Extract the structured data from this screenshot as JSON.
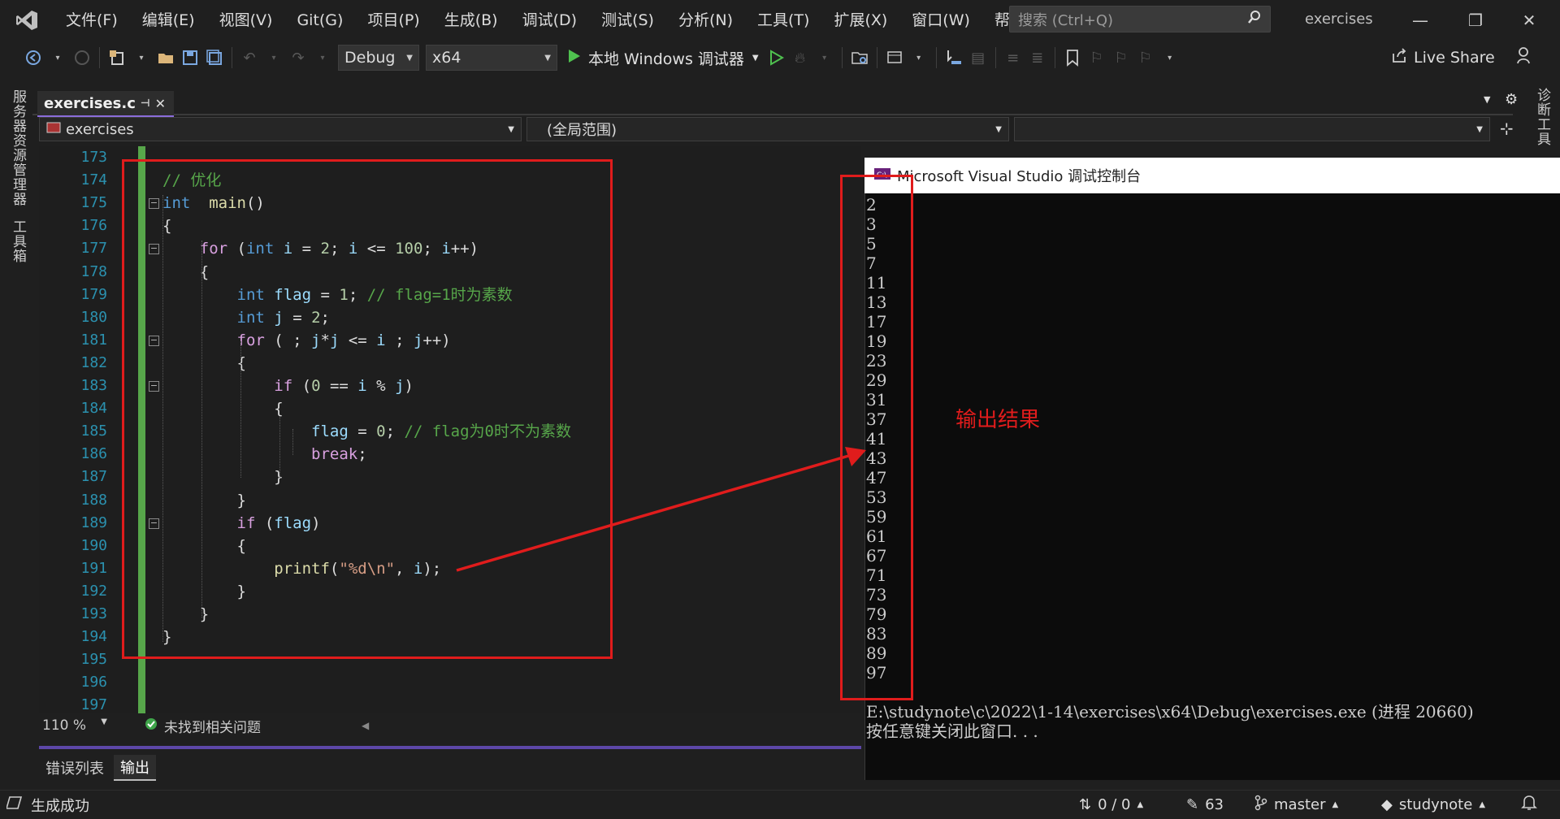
{
  "menubar": {
    "items": [
      "文件(F)",
      "编辑(E)",
      "视图(V)",
      "Git(G)",
      "项目(P)",
      "生成(B)",
      "调试(D)",
      "测试(S)",
      "分析(N)",
      "工具(T)",
      "扩展(X)",
      "窗口(W)",
      "帮助(H)"
    ],
    "search_placeholder": "搜索 (Ctrl+Q)",
    "solution_name": "exercises"
  },
  "toolbar": {
    "config": "Debug",
    "platform": "x64",
    "run_label": "本地 Windows 调试器",
    "live_share": "Live Share"
  },
  "left_rail": {
    "server_explorer": "服务器资源管理器",
    "toolbox": "工具箱"
  },
  "right_rail": {
    "diagnostic_tools": "诊断工具"
  },
  "editor_tab": {
    "filename": "exercises.c"
  },
  "navbar": {
    "project": "exercises",
    "scope": "(全局范围)",
    "member": ""
  },
  "code": {
    "line_numbers": [
      "173",
      "174",
      "175",
      "176",
      "177",
      "178",
      "179",
      "180",
      "181",
      "182",
      "183",
      "184",
      "185",
      "186",
      "187",
      "188",
      "189",
      "190",
      "191",
      "192",
      "193",
      "194",
      "195",
      "196",
      "197"
    ],
    "lines": [
      {
        "n": "173",
        "tokens": []
      },
      {
        "n": "174",
        "tokens": [
          [
            "cm",
            "// 优化"
          ]
        ]
      },
      {
        "n": "175",
        "tokens": [
          [
            "kw",
            "int"
          ],
          [
            "",
            "  "
          ],
          [
            "fn",
            "main"
          ],
          [
            "",
            "()"
          ]
        ]
      },
      {
        "n": "176",
        "tokens": [
          [
            "",
            "{"
          ]
        ]
      },
      {
        "n": "177",
        "tokens": [
          [
            "",
            "    "
          ],
          [
            "ctl",
            "for"
          ],
          [
            "",
            " ("
          ],
          [
            "kw",
            "int"
          ],
          [
            "",
            " "
          ],
          [
            "var",
            "i"
          ],
          [
            "",
            " = "
          ],
          [
            "num",
            "2"
          ],
          [
            "",
            "; "
          ],
          [
            "var",
            "i"
          ],
          [
            "",
            " <= "
          ],
          [
            "num",
            "100"
          ],
          [
            "",
            "; "
          ],
          [
            "var",
            "i"
          ],
          [
            "",
            "++)"
          ]
        ]
      },
      {
        "n": "178",
        "tokens": [
          [
            "",
            "    {"
          ]
        ]
      },
      {
        "n": "179",
        "tokens": [
          [
            "",
            "        "
          ],
          [
            "kw",
            "int"
          ],
          [
            "",
            " "
          ],
          [
            "var",
            "flag"
          ],
          [
            "",
            " = "
          ],
          [
            "num",
            "1"
          ],
          [
            "",
            "; "
          ],
          [
            "cm",
            "// flag=1时为素数"
          ]
        ]
      },
      {
        "n": "180",
        "tokens": [
          [
            "",
            "        "
          ],
          [
            "kw",
            "int"
          ],
          [
            "",
            " "
          ],
          [
            "var",
            "j"
          ],
          [
            "",
            " = "
          ],
          [
            "num",
            "2"
          ],
          [
            "",
            ";"
          ]
        ]
      },
      {
        "n": "181",
        "tokens": [
          [
            "",
            "        "
          ],
          [
            "ctl",
            "for"
          ],
          [
            "",
            " ( ; "
          ],
          [
            "var",
            "j"
          ],
          [
            "",
            "*"
          ],
          [
            "var",
            "j"
          ],
          [
            "",
            " <= "
          ],
          [
            "var",
            "i"
          ],
          [
            "",
            " ; "
          ],
          [
            "var",
            "j"
          ],
          [
            "",
            "++)"
          ]
        ]
      },
      {
        "n": "182",
        "tokens": [
          [
            "",
            "        {"
          ]
        ]
      },
      {
        "n": "183",
        "tokens": [
          [
            "",
            "            "
          ],
          [
            "ctl",
            "if"
          ],
          [
            "",
            " ("
          ],
          [
            "num",
            "0"
          ],
          [
            "",
            " == "
          ],
          [
            "var",
            "i"
          ],
          [
            "",
            " % "
          ],
          [
            "var",
            "j"
          ],
          [
            "",
            ")"
          ]
        ]
      },
      {
        "n": "184",
        "tokens": [
          [
            "",
            "            {"
          ]
        ]
      },
      {
        "n": "185",
        "tokens": [
          [
            "",
            "                "
          ],
          [
            "var",
            "flag"
          ],
          [
            "",
            " = "
          ],
          [
            "num",
            "0"
          ],
          [
            "",
            "; "
          ],
          [
            "cm",
            "// flag为0时不为素数"
          ]
        ]
      },
      {
        "n": "186",
        "tokens": [
          [
            "",
            "                "
          ],
          [
            "ctl",
            "break"
          ],
          [
            "",
            ";"
          ]
        ]
      },
      {
        "n": "187",
        "tokens": [
          [
            "",
            "            }"
          ]
        ]
      },
      {
        "n": "188",
        "tokens": [
          [
            "",
            "        }"
          ]
        ]
      },
      {
        "n": "189",
        "tokens": [
          [
            "",
            "        "
          ],
          [
            "ctl",
            "if"
          ],
          [
            "",
            " ("
          ],
          [
            "var",
            "flag"
          ],
          [
            "",
            ")"
          ]
        ]
      },
      {
        "n": "190",
        "tokens": [
          [
            "",
            "        {"
          ]
        ]
      },
      {
        "n": "191",
        "tokens": [
          [
            "",
            "            "
          ],
          [
            "fn",
            "printf"
          ],
          [
            "",
            "("
          ],
          [
            "str",
            "\"%d\\n\""
          ],
          [
            "",
            ", "
          ],
          [
            "var",
            "i"
          ],
          [
            "",
            ");"
          ]
        ]
      },
      {
        "n": "192",
        "tokens": [
          [
            "",
            "        }"
          ]
        ]
      },
      {
        "n": "193",
        "tokens": [
          [
            "",
            "    }"
          ]
        ]
      },
      {
        "n": "194",
        "tokens": [
          [
            "",
            "}"
          ]
        ]
      },
      {
        "n": "195",
        "tokens": []
      },
      {
        "n": "196",
        "tokens": []
      },
      {
        "n": "197",
        "tokens": []
      }
    ]
  },
  "editor_status": {
    "zoom": "110 %",
    "issues": "未找到相关问题"
  },
  "bottom_panel": {
    "tabs": [
      "错误列表",
      "输出"
    ],
    "active": "输出"
  },
  "statusbar": {
    "left": "生成成功",
    "changes": "0 / 0",
    "edits": "63",
    "branch": "master",
    "repo": "studynote"
  },
  "console": {
    "title": "Microsoft Visual Studio 调试控制台",
    "output": [
      "2",
      "3",
      "5",
      "7",
      "11",
      "13",
      "17",
      "19",
      "23",
      "29",
      "31",
      "37",
      "41",
      "43",
      "47",
      "53",
      "59",
      "61",
      "67",
      "71",
      "73",
      "79",
      "83",
      "89",
      "97"
    ],
    "exit_line": "E:\\studynote\\c\\2022\\1-14\\exercises\\x64\\Debug\\exercises.exe (进程 20660)",
    "prompt_line": "按任意键关闭此窗口. . ."
  },
  "annotation": {
    "label": "输出结果",
    "color": "#e01c1c"
  },
  "colors": {
    "keyword": "#569cd6",
    "control": "#d8a0df",
    "comment": "#57a64a",
    "number": "#b5cea8",
    "string": "#d69d85",
    "accent": "#8b6ddb"
  }
}
